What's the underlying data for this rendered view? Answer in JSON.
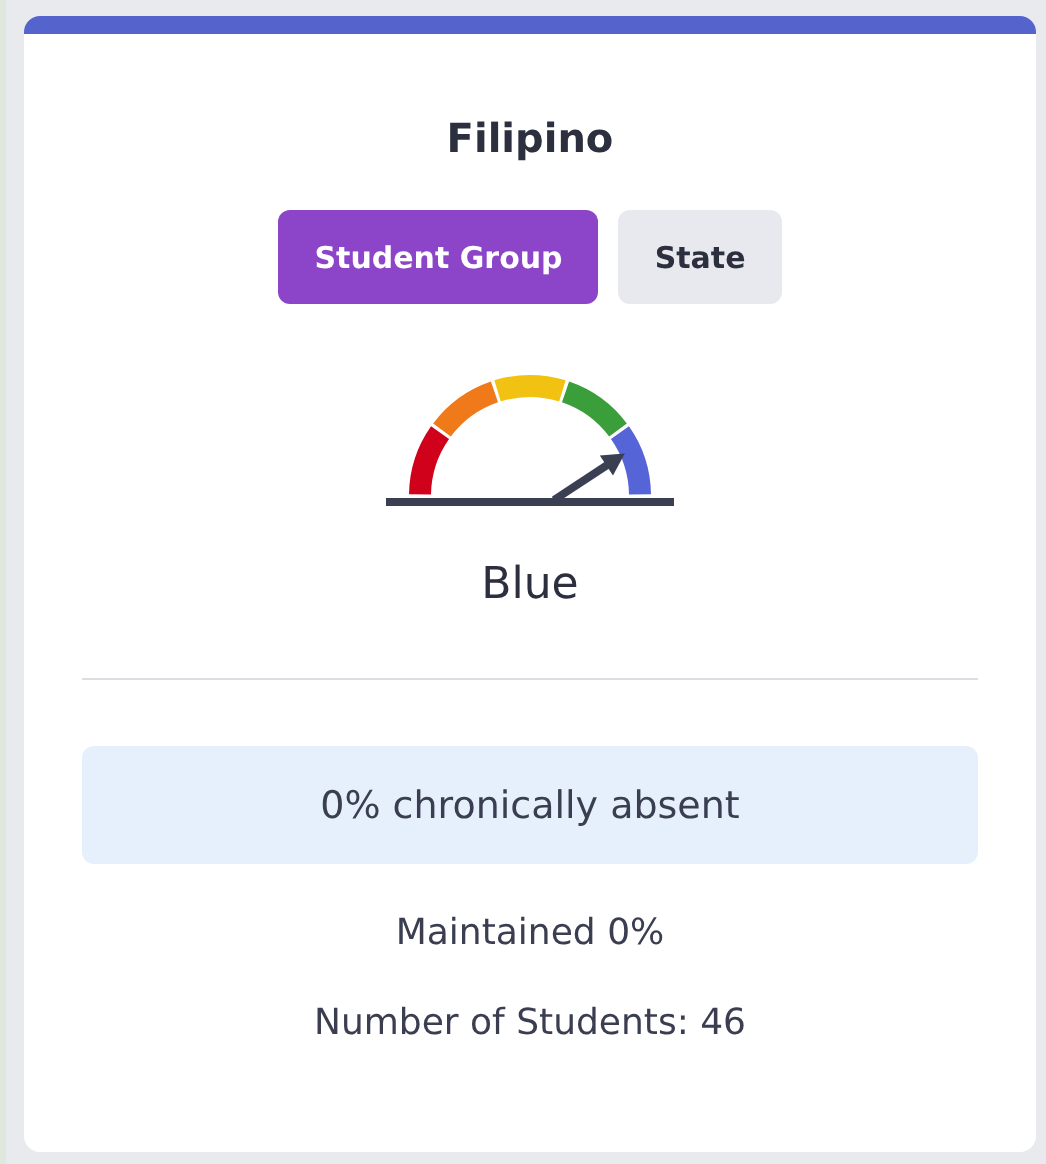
{
  "card": {
    "title": "Filipino",
    "tabs": [
      {
        "label": "Student Group",
        "selected": true
      },
      {
        "label": "State",
        "selected": false
      }
    ],
    "gauge": {
      "label": "Blue"
    },
    "highlight": "0% chronically absent",
    "change": "Maintained 0%",
    "students": "Number of Students: 46"
  }
}
